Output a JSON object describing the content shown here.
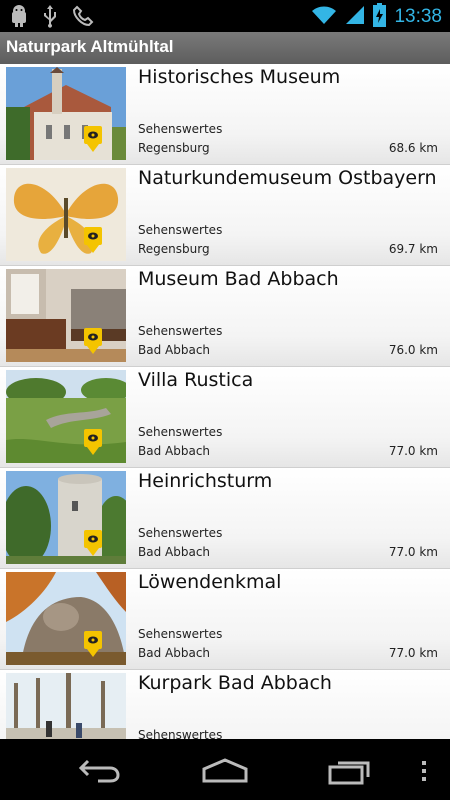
{
  "status_bar": {
    "time": "13:38",
    "left_icons": [
      "android-debug-icon",
      "usb-icon",
      "call-icon"
    ],
    "right_icons": [
      "wifi-icon",
      "signal-icon",
      "battery-icon"
    ]
  },
  "app": {
    "title": "Naturpark Altmühltal"
  },
  "items": [
    {
      "title": "Historisches Museum",
      "category": "Sehenswertes",
      "location": "Regensburg",
      "distance": "68.6 km"
    },
    {
      "title": "Naturkundemuseum Ostbayern",
      "category": "Sehenswertes",
      "location": "Regensburg",
      "distance": "69.7 km"
    },
    {
      "title": "Museum Bad Abbach",
      "category": "Sehenswertes",
      "location": "Bad Abbach",
      "distance": "76.0 km"
    },
    {
      "title": "Villa Rustica",
      "category": "Sehenswertes",
      "location": "Bad Abbach",
      "distance": "77.0 km"
    },
    {
      "title": "Heinrichsturm",
      "category": "Sehenswertes",
      "location": "Bad Abbach",
      "distance": "77.0 km"
    },
    {
      "title": "Löwendenkmal",
      "category": "Sehenswertes",
      "location": "Bad Abbach",
      "distance": "77.0 km"
    },
    {
      "title": "Kurpark Bad Abbach",
      "category": "Sehenswertes",
      "location": "",
      "distance": ""
    }
  ],
  "nav_bar": [
    "back-icon",
    "home-icon",
    "recent-apps-icon",
    "menu-icon"
  ],
  "colors": {
    "accent": "#33b5e5",
    "pin": "#f4c400",
    "titlebar": "#6b6b6b"
  }
}
